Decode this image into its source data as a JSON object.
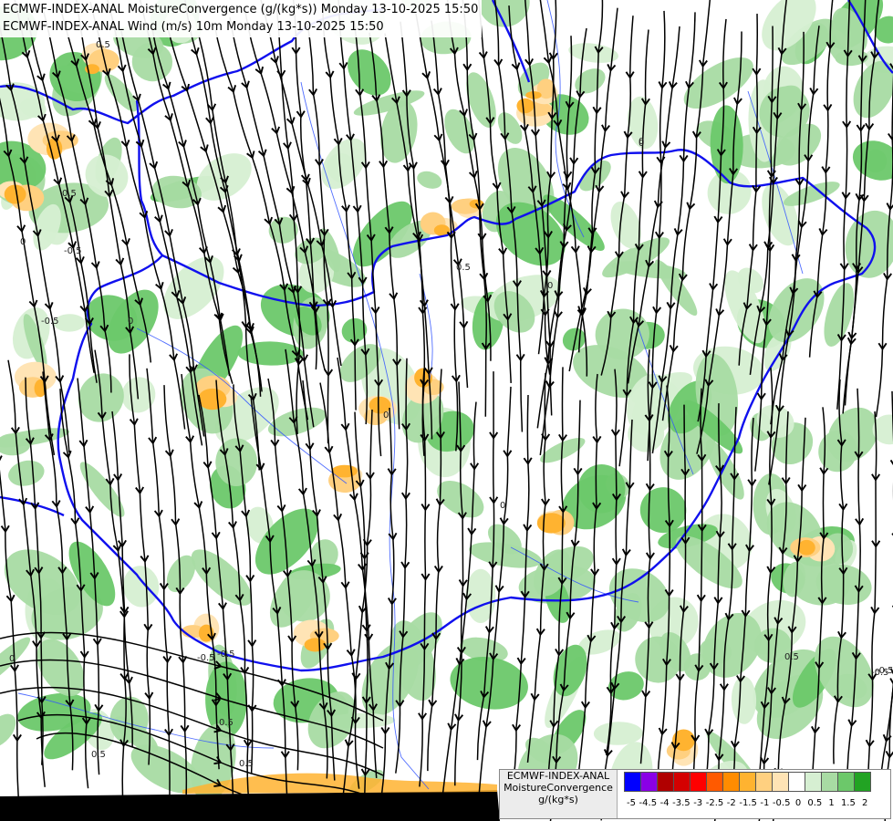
{
  "title": {
    "line1": "ECMWF-INDEX-ANAL MoistureConvergence (g/(kg*s)) Monday 13-10-2025 15:50",
    "line2": "ECMWF-INDEX-ANAL Wind (m/s) 10m Monday 13-10-2025 15:50"
  },
  "legend": {
    "line1": "ECMWF-INDEX-ANAL",
    "line2": "MoistureConvergence",
    "unit": "g/(kg*s)",
    "scale": [
      {
        "label": "-5",
        "color": "#0000ff"
      },
      {
        "label": "-4.5",
        "color": "#8a00e6"
      },
      {
        "label": "-4",
        "color": "#b00000"
      },
      {
        "label": "-3.5",
        "color": "#d40000"
      },
      {
        "label": "-3",
        "color": "#ff0000"
      },
      {
        "label": "-2.5",
        "color": "#ff5a00"
      },
      {
        "label": "-2",
        "color": "#ff8c00"
      },
      {
        "label": "-1.5",
        "color": "#ffb330"
      },
      {
        "label": "-1",
        "color": "#ffd080"
      },
      {
        "label": "-0.5",
        "color": "#ffe4b5"
      },
      {
        "label": "0",
        "color": "#ffffff"
      },
      {
        "label": "0.5",
        "color": "#d6efd2"
      },
      {
        "label": "1",
        "color": "#a8dba3"
      },
      {
        "label": "1.5",
        "color": "#6cc86a"
      },
      {
        "label": "2",
        "color": "#22a323"
      }
    ]
  },
  "contour_labels": [
    "0.5",
    "0",
    "0.5",
    "-0.5",
    "0",
    "0",
    "0",
    "-0.5",
    "0.5",
    "-0.5",
    "0.5",
    "0.5",
    "0",
    "0",
    "-0.5",
    "0.5",
    "0.5",
    "-0.5",
    "-0.5",
    "0",
    "0"
  ],
  "colors": {
    "border": "#1010ee",
    "rivers": "#3355ff",
    "streamline": "#000000",
    "land_mask": "#000000"
  }
}
